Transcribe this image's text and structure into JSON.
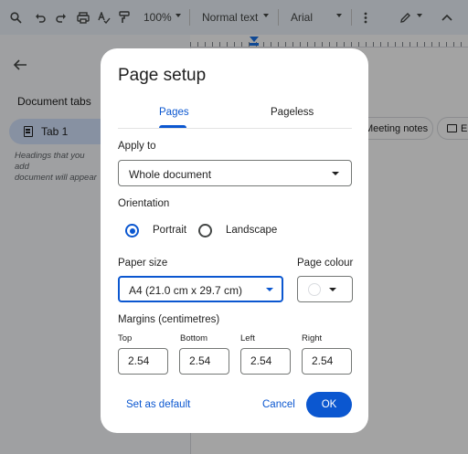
{
  "toolbar": {
    "zoom": "100%",
    "style": "Normal text",
    "font": "Arial",
    "icons": [
      "search-icon",
      "undo-icon",
      "redo-icon",
      "print-icon",
      "spellcheck-icon",
      "paint-format-icon",
      "more-vert-icon",
      "edit-mode-icon"
    ]
  },
  "sidebar": {
    "title": "Document tabs",
    "tab_label": "Tab 1",
    "hint": "Headings that you add\ndocument will appear"
  },
  "chips": {
    "meeting_notes": "Meeting notes",
    "other": "E"
  },
  "dialog": {
    "title": "Page setup",
    "tabs": [
      "Pages",
      "Pageless"
    ],
    "active_tab": "Pages",
    "apply_to_label": "Apply to",
    "apply_to_value": "Whole document",
    "orientation_label": "Orientation",
    "orientation_options": [
      "Portrait",
      "Landscape"
    ],
    "orientation_selected": "Portrait",
    "paper_size_label": "Paper size",
    "paper_size_value": "A4 (21.0 cm x 29.7 cm)",
    "page_colour_label": "Page colour",
    "page_colour_value": "#ffffff",
    "margins_label": "Margins (centimetres)",
    "margins": [
      {
        "label": "Top",
        "value": "2.54"
      },
      {
        "label": "Bottom",
        "value": "2.54"
      },
      {
        "label": "Left",
        "value": "2.54"
      },
      {
        "label": "Right",
        "value": "2.54"
      }
    ],
    "set_default_label": "Set as default",
    "cancel_label": "Cancel",
    "ok_label": "OK"
  },
  "colors": {
    "accent": "#0b57d0",
    "toolbar_bg": "#edf2fa",
    "tab_pill": "#d3e3fd"
  }
}
